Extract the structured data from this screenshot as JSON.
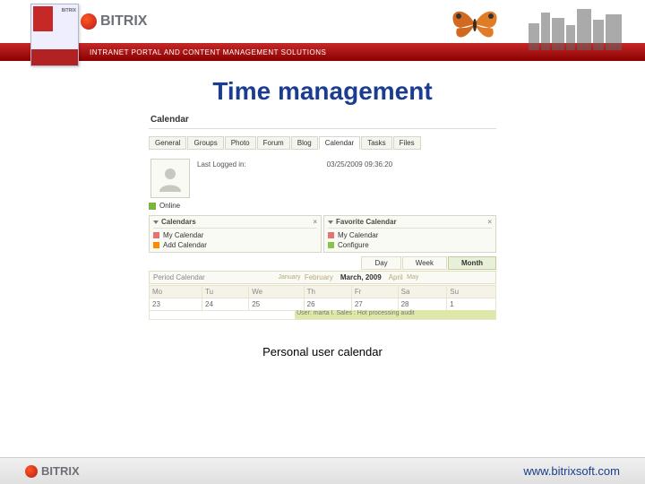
{
  "header": {
    "brand": "BITRIX",
    "tagline": "INTRANET PORTAL AND CONTENT MANAGEMENT SOLUTIONS"
  },
  "title": "Time management",
  "caption": "Personal user calendar",
  "footer": {
    "brand": "BITRIX",
    "url": "www.bitrixsoft.com"
  },
  "cal": {
    "heading": "Calendar",
    "tabs": [
      "General",
      "Groups",
      "Photo",
      "Forum",
      "Blog",
      "Calendar",
      "Tasks",
      "Files"
    ],
    "active_tab": 5,
    "last_login_label": "Last Logged in:",
    "last_login_value": "03/25/2009 09:36:20",
    "online": "Online",
    "panel_calendars": {
      "title": "Calendars",
      "items": [
        "My Calendar",
        "Add Calendar"
      ]
    },
    "panel_favorite": {
      "title": "Favorite Calendar",
      "items": [
        "My Calendar",
        "Configure"
      ]
    },
    "views": [
      "Day",
      "Week",
      "Month"
    ],
    "active_view": 2,
    "month_strip": {
      "label": "Period Calendar",
      "prev2": "January",
      "prev": "February",
      "current": "March, 2009",
      "next": "April",
      "next2": "May"
    },
    "weekdays": [
      "Mo",
      "Tu",
      "We",
      "Th",
      "Fr",
      "Sa",
      "Su"
    ],
    "row1": [
      "23",
      "24",
      "25",
      "26",
      "27",
      "28",
      "1"
    ],
    "event_text": "User: marta I. Sales : Hot processing audit"
  }
}
